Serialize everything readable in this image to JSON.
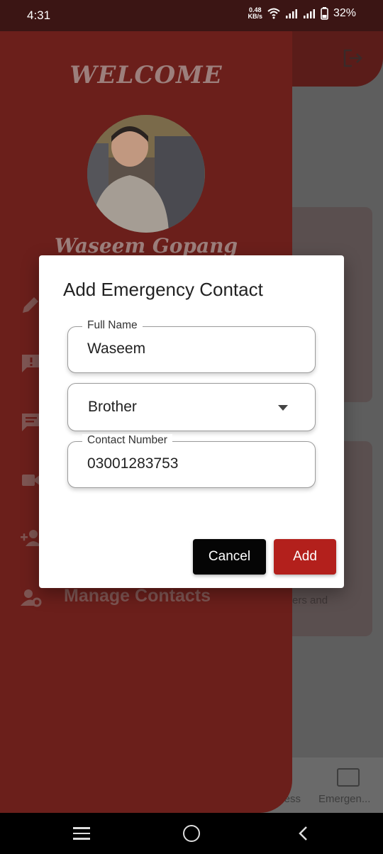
{
  "status_bar": {
    "time": "4:31",
    "net_speed_value": "0.48",
    "net_speed_unit": "KB/s",
    "battery": "32%"
  },
  "drawer": {
    "welcome": "WELCOME",
    "user_name": "Waseem Gopang",
    "manage_contacts_label": "Manage Contacts"
  },
  "background": {
    "card_text_1": "ers and",
    "nav_awareness": "eness",
    "nav_emergency": "Emergen..."
  },
  "dialog": {
    "title": "Add Emergency Contact",
    "full_name_label": "Full Name",
    "full_name_value": "Waseem",
    "relation_value": "Brother",
    "contact_label": "Contact Number",
    "contact_value": "03001283753",
    "cancel_label": "Cancel",
    "add_label": "Add"
  },
  "colors": {
    "accent_red": "#b3201c",
    "drawer_bg": "#6b1f1b",
    "cancel_black": "#050505"
  },
  "icons": [
    "wifi-icon",
    "signal-icon",
    "battery-icon",
    "logout-icon",
    "edit-icon",
    "report-icon",
    "chat-icon",
    "video-icon",
    "add-contact-icon",
    "manage-contacts-icon",
    "dropdown-arrow-icon",
    "recents-icon",
    "home-icon",
    "back-icon"
  ]
}
